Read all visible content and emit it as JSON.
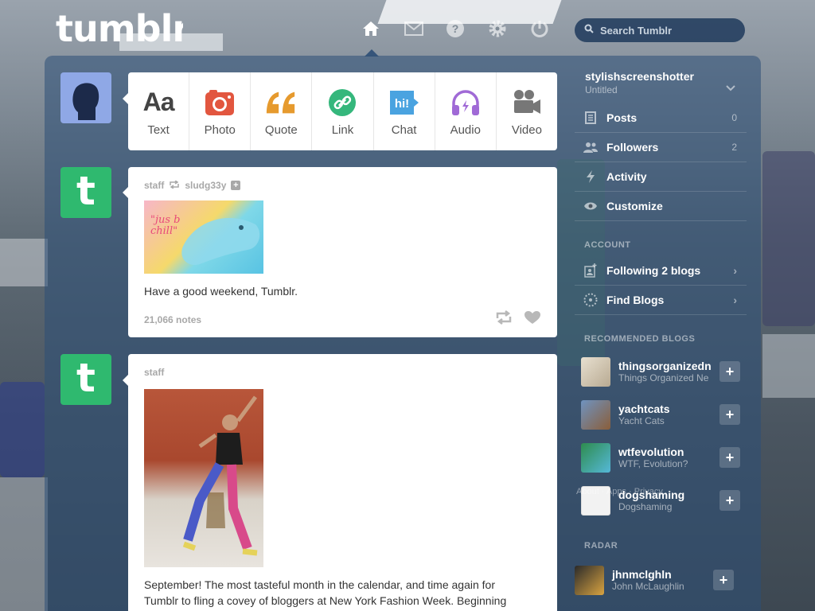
{
  "header": {
    "logo": "tumblr",
    "search_placeholder": "Search Tumblr",
    "nav": [
      "home-icon",
      "mail-icon",
      "help-icon",
      "gear-icon",
      "power-icon"
    ]
  },
  "post_types": [
    {
      "label": "Text",
      "icon": "text-icon",
      "glyph": "Aa",
      "color": "#444444"
    },
    {
      "label": "Photo",
      "icon": "camera-icon",
      "color": "#e2563f"
    },
    {
      "label": "Quote",
      "icon": "quote-icon",
      "glyph": "66",
      "color": "#e69a2e"
    },
    {
      "label": "Link",
      "icon": "link-icon",
      "color": "#35b77c"
    },
    {
      "label": "Chat",
      "icon": "chat-icon",
      "glyph": "hi!",
      "color": "#4aa3e0"
    },
    {
      "label": "Audio",
      "icon": "headphones-icon",
      "color": "#a06ad6"
    },
    {
      "label": "Video",
      "icon": "video-camera-icon",
      "color": "#888888"
    }
  ],
  "posts": [
    {
      "author": "staff",
      "reblogged_from": "sludg33y",
      "image_text": "\"jus b chill\"",
      "caption": "Have a good weekend, Tumblr.",
      "notes": "21,066 notes"
    },
    {
      "author": "staff",
      "caption_line1": "September! The most tasteful month in the calendar, and time again for",
      "caption_line2": "Tumblr to fling a covey of bloggers at New York Fashion Week. Beginning"
    }
  ],
  "sidebar": {
    "blog_name": "stylishscreenshotter",
    "blog_subtitle": "Untitled",
    "items": [
      {
        "label": "Posts",
        "count": "0",
        "icon": "posts-icon"
      },
      {
        "label": "Followers",
        "count": "2",
        "icon": "followers-icon"
      },
      {
        "label": "Activity",
        "count": "",
        "icon": "lightning-icon"
      },
      {
        "label": "Customize",
        "count": "",
        "icon": "eye-icon"
      }
    ],
    "account_heading": "ACCOUNT",
    "account_items": [
      {
        "label": "Following 2 blogs",
        "icon": "following-icon"
      },
      {
        "label": "Find Blogs",
        "icon": "compass-icon"
      }
    ],
    "recommended_heading": "RECOMMENDED BLOGS",
    "recommended": [
      {
        "name": "thingsorganizedn",
        "sub": "Things Organized Ne",
        "thumb_color": "#c9c2b4"
      },
      {
        "name": "yachtcats",
        "sub": "Yacht Cats",
        "thumb_color": "#5a7fa8"
      },
      {
        "name": "wtfevolution",
        "sub": "WTF, Evolution?",
        "thumb_color": "#3c9b5e"
      },
      {
        "name": "dogshaming",
        "sub": "Dogshaming",
        "thumb_color": "#f2f2f2"
      }
    ],
    "footer_links": "About · Apps · Privacy",
    "radar_heading": "RADAR",
    "radar": {
      "name": "jhnmclghln",
      "sub": "John McLaughlin",
      "thumb_color": "#d9a441"
    }
  }
}
